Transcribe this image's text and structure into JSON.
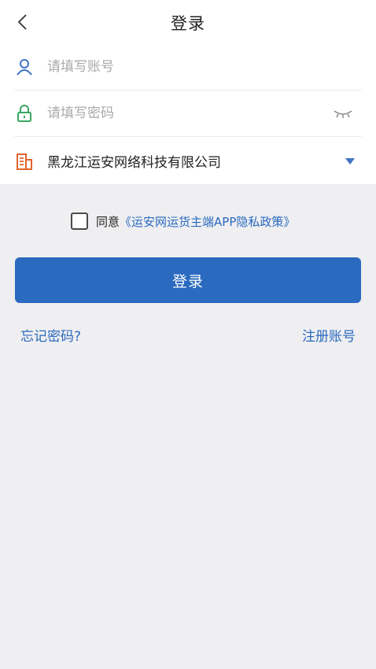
{
  "header": {
    "title": "登录",
    "back_icon": "back-chevron-icon"
  },
  "form": {
    "account": {
      "placeholder": "请填写账号",
      "icon": "user-icon",
      "icon_color": "#3f74c4"
    },
    "password": {
      "placeholder": "请填写密码",
      "icon": "lock-icon",
      "icon_color": "#3aa661",
      "toggle_icon": "eye-closed-icon"
    },
    "company": {
      "value": "黑龙江运安网络科技有限公司",
      "icon": "building-icon",
      "icon_color": "#e0652c",
      "dropdown_icon": "triangle-down-icon"
    }
  },
  "agreement": {
    "prefix": "同意",
    "link_text": "《运安网运货主端APP隐私政策》",
    "checked": false
  },
  "login_button": "登录",
  "forgot_password": "忘记密码?",
  "register": "注册账号",
  "colors": {
    "primary": "#2a6abf",
    "background": "#efeff1",
    "white": "#ffffff"
  }
}
